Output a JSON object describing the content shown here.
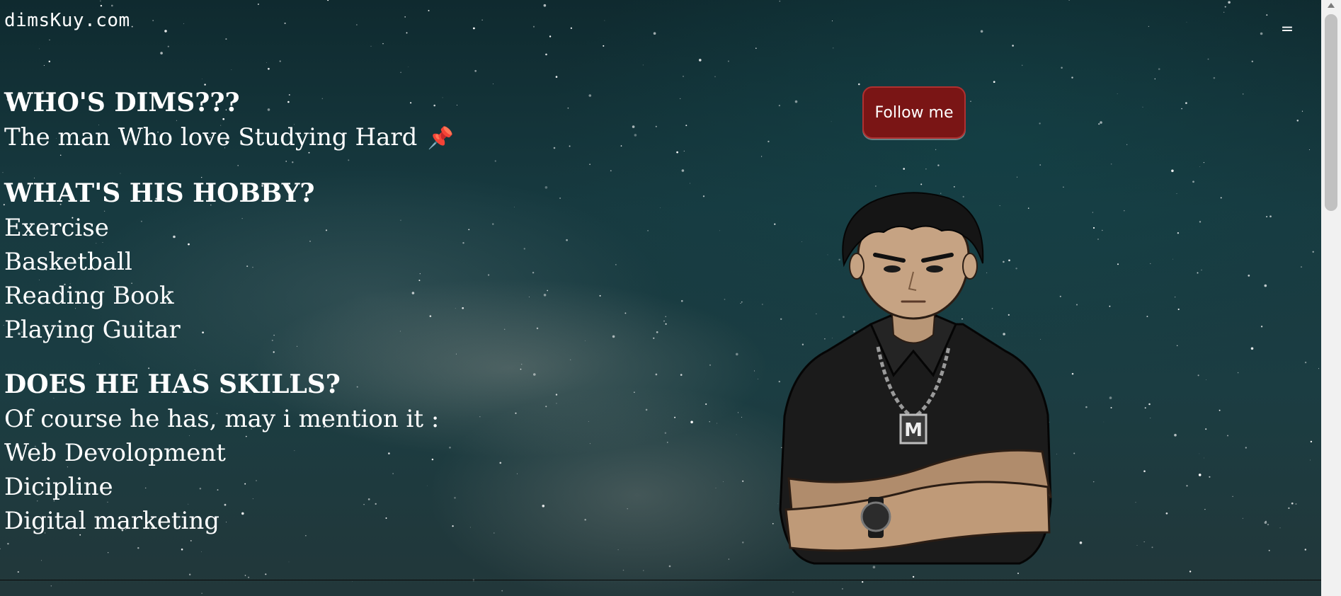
{
  "header": {
    "brand": "dimsKuy.com",
    "menu_glyph": "="
  },
  "sections": [
    {
      "heading": "WHO'S DIMS???",
      "lines": [
        "The man Who love Studying Hard"
      ],
      "pin": "📌"
    },
    {
      "heading": "WHAT'S HIS HOBBY?",
      "lines": [
        "Exercise",
        "Basketball",
        "Reading Book",
        "Playing Guitar"
      ]
    },
    {
      "heading": "DOES HE HAS SKILLS?",
      "lines": [
        "Of course he has, may i mention it :",
        "Web Devolopment",
        "Dicipline",
        "Digital marketing"
      ]
    }
  ],
  "follow_button": {
    "label": "Follow me",
    "color": "#7a1515"
  },
  "avatar": {
    "badge_letter": "M"
  },
  "theme": {
    "text": "#ffffff",
    "sky": "#173a40"
  }
}
